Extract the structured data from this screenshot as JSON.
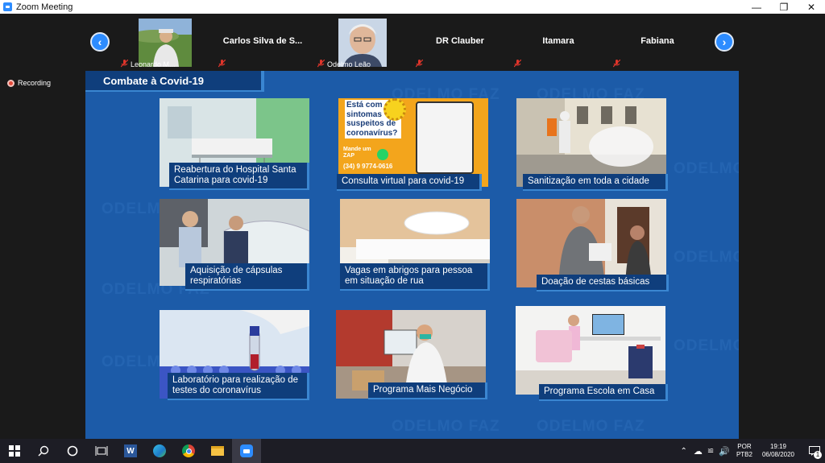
{
  "window": {
    "title": "Zoom Meeting"
  },
  "participants": [
    {
      "name": "Leonardo M...",
      "muted": true,
      "video": true
    },
    {
      "name": "Carlos Silva de S...",
      "muted": true,
      "video": false
    },
    {
      "name": "Odelmo Leão",
      "muted": true,
      "video": true
    },
    {
      "name": "DR Clauber",
      "muted": true,
      "video": false
    },
    {
      "name": "Itamara",
      "muted": true,
      "video": false
    },
    {
      "name": "Fabiana",
      "muted": true,
      "video": false
    }
  ],
  "recording": {
    "label": "Recording"
  },
  "slide": {
    "header": "Combate à Covid-19",
    "watermark": "ODELMO FAZ",
    "cards": [
      {
        "caption": "Reabertura do Hospital Santa Catarina para covid-19"
      },
      {
        "caption": "Consulta virtual para covid-19",
        "ad_lines": [
          "Está com",
          "sintomas",
          "suspeitos de",
          "coronavírus?"
        ],
        "ad_cta": "Mande um ZAP",
        "ad_phone": "(34) 9 9774-0616"
      },
      {
        "caption": "Sanitização em toda a cidade"
      },
      {
        "caption": "Aquisição de cápsulas respiratórias"
      },
      {
        "caption": "Vagas em abrigos para pessoa em situação de rua"
      },
      {
        "caption": "Doação de cestas básicas"
      },
      {
        "caption": "Laboratório para realização de testes do coronavírus"
      },
      {
        "caption": "Programa Mais Negócio"
      },
      {
        "caption": "Programa Escola em Casa"
      }
    ]
  },
  "taskbar": {
    "lang_line1": "POR",
    "lang_line2": "PTB2",
    "time": "19:19",
    "date": "06/08/2020",
    "notification_count": "1"
  },
  "colors": {
    "zoom_blue": "#2d8cff",
    "slide_bg": "#1c5ba8",
    "caption_bg": "#0f3e7c",
    "mute_red": "#e0352b"
  }
}
